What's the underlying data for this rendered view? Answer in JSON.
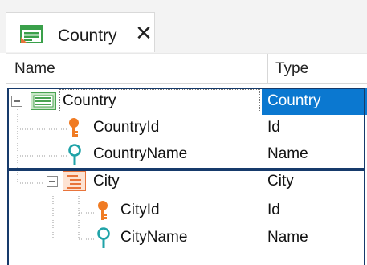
{
  "tab": {
    "title": "Country",
    "close_glyph": "✕",
    "icon": "transaction-icon"
  },
  "columns": {
    "name": "Name",
    "type": "Type"
  },
  "rows": [
    {
      "name": "Country",
      "type": "Country",
      "kind": "level",
      "icon": "transaction-level-icon",
      "expander": "minus",
      "selected": true
    },
    {
      "name": "CountryId",
      "type": "Id",
      "kind": "key",
      "icon": "primary-key-icon"
    },
    {
      "name": "CountryName",
      "type": "Name",
      "kind": "attr",
      "icon": "description-attribute-icon"
    },
    {
      "name": "City",
      "type": "City",
      "kind": "sublevel",
      "icon": "subordinated-level-icon",
      "expander": "minus"
    },
    {
      "name": "CityId",
      "type": "Id",
      "kind": "key",
      "icon": "primary-key-icon"
    },
    {
      "name": "CityName",
      "type": "Name",
      "kind": "attr",
      "icon": "description-attribute-icon"
    }
  ],
  "colors": {
    "selection": "#0b78d0",
    "group_border": "#163a6b",
    "key_orange": "#f07b23",
    "attr_teal": "#20a3a8",
    "level_green": "#39a845",
    "sublevel_orange": "#e8743b"
  }
}
